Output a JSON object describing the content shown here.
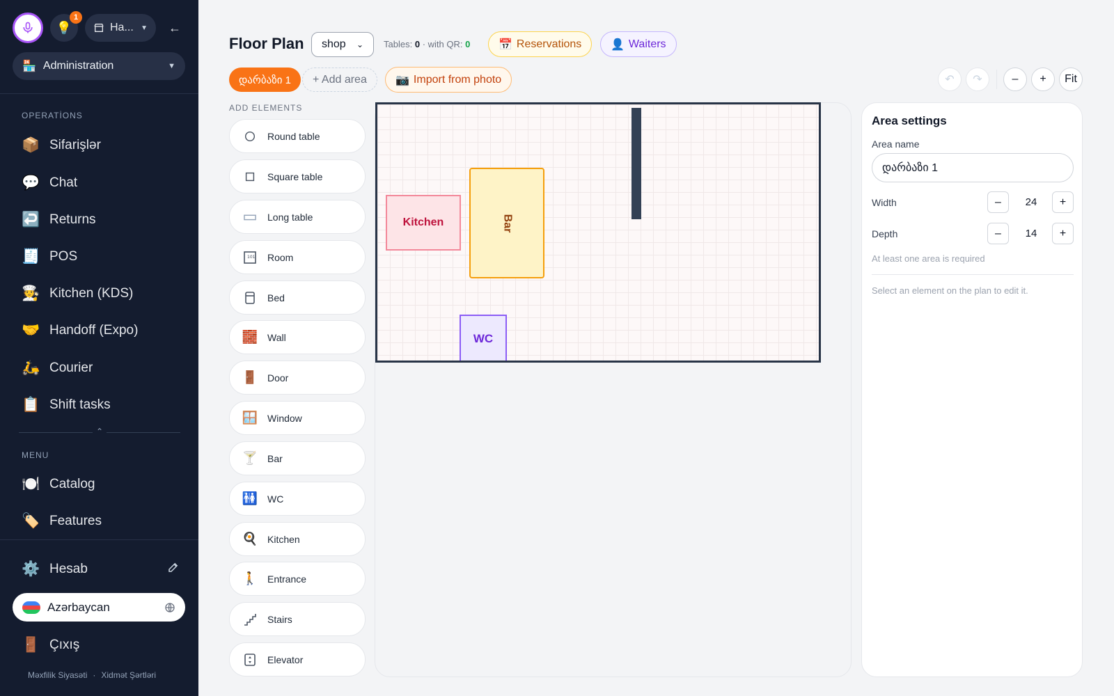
{
  "sidebar": {
    "store_label": "Ha...",
    "notification_count": "1",
    "admin_select": "Administration",
    "operations_heading": "OPERATİONS",
    "operations": [
      {
        "icon": "📦",
        "label": "Sifarişlər"
      },
      {
        "icon": "💬",
        "label": "Chat"
      },
      {
        "icon": "↩️",
        "label": "Returns"
      },
      {
        "icon": "🧾",
        "label": "POS"
      },
      {
        "icon": "🧑‍🍳",
        "label": "Kitchen (KDS)"
      },
      {
        "icon": "🤝",
        "label": "Handoff (Expo)"
      },
      {
        "icon": "🛵",
        "label": "Courier"
      },
      {
        "icon": "📋",
        "label": "Shift tasks"
      }
    ],
    "menu_heading": "MENU",
    "menu": [
      {
        "icon": "🍽️",
        "label": "Catalog"
      },
      {
        "icon": "🏷️",
        "label": "Features"
      }
    ],
    "account": {
      "icon": "⚙️",
      "label": "Hesab"
    },
    "language": "Azərbaycan",
    "logout": {
      "icon": "🚪",
      "label": "Çıxış"
    },
    "footer_privacy": "Məxfilik Siyasəti",
    "footer_sep": "·",
    "footer_terms": "Xidmət Şərtləri"
  },
  "header": {
    "title": "Floor Plan",
    "shop_value": "shop",
    "tables_label": "Tables:",
    "tables_count": "0",
    "qr_label": "· with QR:",
    "qr_count": "0",
    "reservations_icon": "📅",
    "reservations_label": "Reservations",
    "waiters_icon": "👤",
    "waiters_label": "Waiters"
  },
  "areas": {
    "active_tab": "დარბაზი 1",
    "add_area": "+ Add area",
    "import_icon": "📷",
    "import_label": "Import from photo"
  },
  "zoom": {
    "undo": "↶",
    "redo": "↷",
    "zoom_out": "–",
    "zoom_in": "+",
    "fit": "Fit"
  },
  "elements": {
    "heading": "ADD ELEMENTS",
    "items": [
      {
        "icon": "round-table-icon",
        "label": "Round table"
      },
      {
        "icon": "square-table-icon",
        "label": "Square table"
      },
      {
        "icon": "long-table-icon",
        "label": "Long table"
      },
      {
        "icon": "room-icon",
        "label": "Room"
      },
      {
        "icon": "bed-icon",
        "label": "Bed"
      },
      {
        "icon": "🧱",
        "label": "Wall"
      },
      {
        "icon": "🚪",
        "label": "Door"
      },
      {
        "icon": "🪟",
        "label": "Window"
      },
      {
        "icon": "🍸",
        "label": "Bar"
      },
      {
        "icon": "🚻",
        "label": "WC"
      },
      {
        "icon": "🍳",
        "label": "Kitchen"
      },
      {
        "icon": "🚶",
        "label": "Entrance"
      },
      {
        "icon": "stairs-icon",
        "label": "Stairs"
      },
      {
        "icon": "elevator-icon",
        "label": "Elevator"
      }
    ]
  },
  "plan": {
    "kitchen_label": "Kitchen",
    "bar_label": "Bar",
    "wc_label": "WC"
  },
  "settings": {
    "title": "Area settings",
    "name_label": "Area name",
    "name_value": "დარბაზი 1",
    "width_label": "Width",
    "width_value": "24",
    "depth_label": "Depth",
    "depth_value": "14",
    "minus": "–",
    "plus": "+",
    "note": "At least one area is required",
    "hint": "Select an element on the plan to edit it."
  },
  "colors": {
    "sidebar_bg": "#141c2f",
    "accent_orange": "#f97316",
    "accent_purple": "#a855f7"
  }
}
